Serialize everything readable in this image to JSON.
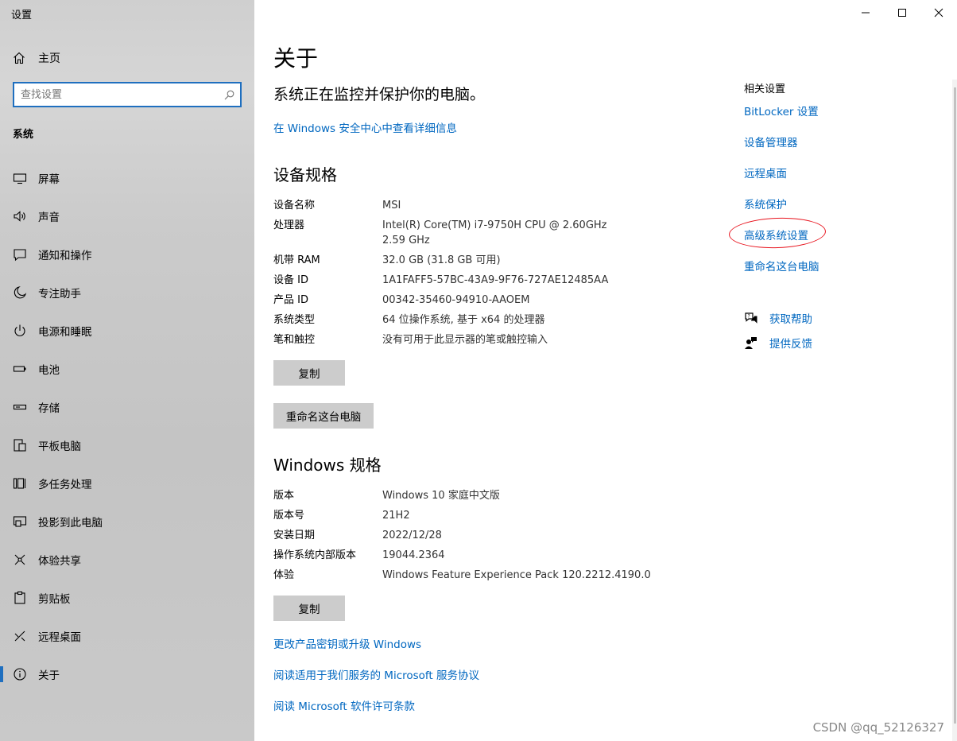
{
  "window": {
    "title": "设置"
  },
  "sidebar": {
    "home_label": "主页",
    "search_placeholder": "查找设置",
    "section_title": "系统",
    "items": [
      {
        "label": "屏幕",
        "icon": "monitor-icon"
      },
      {
        "label": "声音",
        "icon": "speaker-icon"
      },
      {
        "label": "通知和操作",
        "icon": "notification-icon"
      },
      {
        "label": "专注助手",
        "icon": "moon-icon"
      },
      {
        "label": "电源和睡眠",
        "icon": "power-icon"
      },
      {
        "label": "电池",
        "icon": "battery-icon"
      },
      {
        "label": "存储",
        "icon": "storage-icon"
      },
      {
        "label": "平板电脑",
        "icon": "tablet-icon"
      },
      {
        "label": "多任务处理",
        "icon": "multitask-icon"
      },
      {
        "label": "投影到此电脑",
        "icon": "project-icon"
      },
      {
        "label": "体验共享",
        "icon": "share-icon"
      },
      {
        "label": "剪贴板",
        "icon": "clipboard-icon"
      },
      {
        "label": "远程桌面",
        "icon": "remote-icon"
      },
      {
        "label": "关于",
        "icon": "info-icon",
        "active": true
      }
    ]
  },
  "main": {
    "title": "关于",
    "protect_text": "系统正在监控并保护你的电脑。",
    "security_link": "在 Windows 安全中心中查看详细信息",
    "device_specs": {
      "heading": "设备规格",
      "rows": [
        {
          "key": "设备名称",
          "value": "MSI"
        },
        {
          "key": "处理器",
          "value": "Intel(R) Core(TM) i7-9750H CPU @ 2.60GHz   2.59 GHz"
        },
        {
          "key": "机带 RAM",
          "value": "32.0 GB (31.8 GB 可用)"
        },
        {
          "key": "设备 ID",
          "value": "1A1FAFF5-57BC-43A9-9F76-727AE12485AA"
        },
        {
          "key": "产品 ID",
          "value": "00342-35460-94910-AAOEM"
        },
        {
          "key": "系统类型",
          "value": "64 位操作系统, 基于 x64 的处理器"
        },
        {
          "key": "笔和触控",
          "value": "没有可用于此显示器的笔或触控输入"
        }
      ],
      "copy_button": "复制",
      "rename_button": "重命名这台电脑"
    },
    "windows_specs": {
      "heading": "Windows 规格",
      "rows": [
        {
          "key": "版本",
          "value": "Windows 10 家庭中文版"
        },
        {
          "key": "版本号",
          "value": "21H2"
        },
        {
          "key": "安装日期",
          "value": "2022/12/28"
        },
        {
          "key": "操作系统内部版本",
          "value": "19044.2364"
        },
        {
          "key": "体验",
          "value": "Windows Feature Experience Pack 120.2212.4190.0"
        }
      ],
      "copy_button": "复制"
    },
    "bottom_links": [
      "更改产品密钥或升级 Windows",
      "阅读适用于我们服务的 Microsoft 服务协议",
      "阅读 Microsoft 软件许可条款"
    ]
  },
  "related": {
    "title": "相关设置",
    "links": [
      "BitLocker 设置",
      "设备管理器",
      "远程桌面",
      "系统保护",
      "高级系统设置",
      "重命名这台电脑"
    ],
    "help_label": "获取帮助",
    "feedback_label": "提供反馈"
  },
  "watermark": "CSDN @qq_52126327",
  "colors": {
    "accent": "#0067c0",
    "annotation_circle": "#e8141e"
  }
}
